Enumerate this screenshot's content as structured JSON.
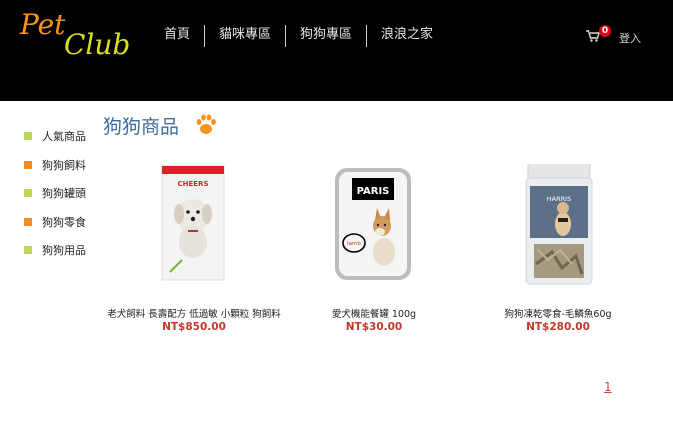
{
  "logo": {
    "word1": "Pet",
    "word2": "Club"
  },
  "nav": [
    "首頁",
    "貓咪專區",
    "狗狗專區",
    "浪浪之家"
  ],
  "cart": {
    "count": "0",
    "icon": "cart-icon"
  },
  "login_label": "登入",
  "sidebar": [
    {
      "label": "人氣商品",
      "color": "#bcd65b"
    },
    {
      "label": "狗狗飼料",
      "color": "#f08c2a"
    },
    {
      "label": "狗狗罐頭",
      "color": "#bcd65b"
    },
    {
      "label": "狗狗零食",
      "color": "#f08c2a"
    },
    {
      "label": "狗狗用品",
      "color": "#bcd65b"
    }
  ],
  "section_title": "狗狗商品",
  "products": [
    {
      "name": "老犬飼料 長壽配方 低過敏 小顆粒 狗飼料",
      "price": "NT$850.00",
      "brand_text": "CHEERS"
    },
    {
      "name": "愛犬機能餐罐 100g",
      "price": "NT$30.00",
      "brand_text": "PARIS",
      "tag_text": "lamb"
    },
    {
      "name": "狗狗凍乾零食-毛鱗魚60g",
      "price": "NT$280.00",
      "brand_text": "HARRIS"
    }
  ],
  "pagination": {
    "current": "1"
  }
}
